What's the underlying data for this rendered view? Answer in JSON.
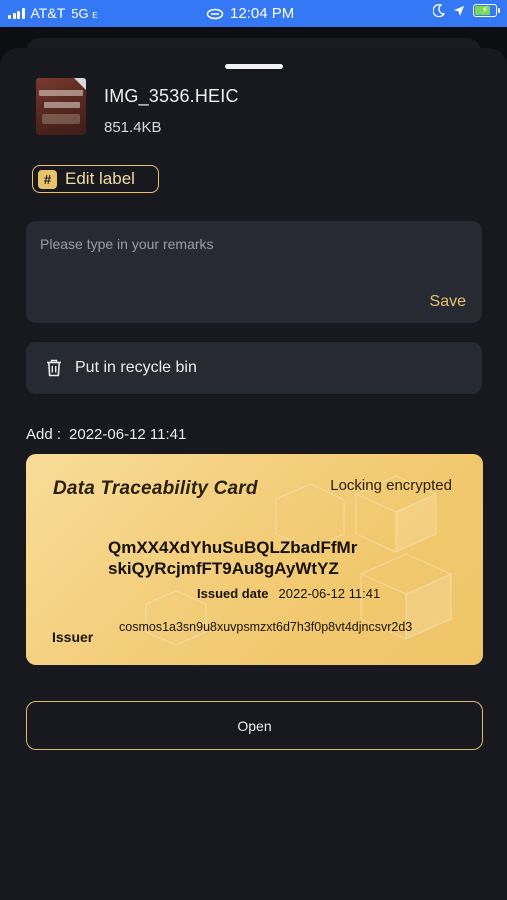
{
  "status_bar": {
    "carrier": "AT&T",
    "network": "5G",
    "network_suffix": "E",
    "time": "12:04 PM"
  },
  "file": {
    "name": "IMG_3536.HEIC",
    "size": "851.4KB"
  },
  "edit_label": "Edit label",
  "remarks": {
    "placeholder": "Please type in your remarks",
    "save_label": "Save"
  },
  "recycle_label": "Put in recycle bin",
  "add": {
    "label": "Add :",
    "value": "2022-06-12 11:41"
  },
  "card": {
    "title": "Data Traceability Card",
    "status": "Locking encrypted",
    "hash_line1": "QmXX4XdYhuSuBQLZbadFfMr",
    "hash_line2": "skiQyRcjmfFT9Au8gAyWtYZ",
    "issued_label": "Issued date",
    "issued_value": "2022-06-12 11:41",
    "issuer_label": "Issuer",
    "issuer_value": "cosmos1a3sn9u8xuvpsmzxt6d7h3f0p8vt4djncsvr2d3"
  },
  "open_label": "Open",
  "colors": {
    "accent_gold": "#e8c36b",
    "status_bar_blue": "#3478f6",
    "sheet_bg": "#18191e",
    "field_bg": "#272933"
  }
}
